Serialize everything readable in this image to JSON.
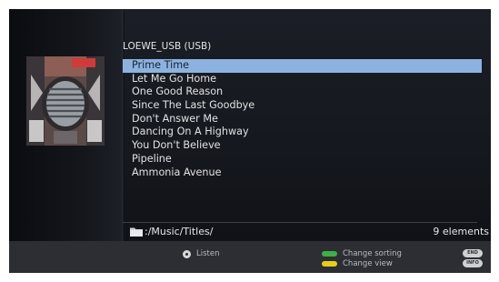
{
  "source": {
    "title": "LOEWE_USB (USB)"
  },
  "tracks": [
    {
      "title": "Prime Time",
      "selected": true
    },
    {
      "title": "Let Me Go Home"
    },
    {
      "title": "One Good Reason"
    },
    {
      "title": "Since The Last Goodbye"
    },
    {
      "title": "Don't Answer Me"
    },
    {
      "title": "Dancing On A Highway"
    },
    {
      "title": "You Don't Believe"
    },
    {
      "title": "Pipeline"
    },
    {
      "title": "Ammonia Avenue"
    }
  ],
  "footer": {
    "path": ":/Music/Titles/",
    "count": "9 elements"
  },
  "hints": {
    "listen": "Listen",
    "green": "Change sorting",
    "yellow": "Change view",
    "end_key": "END",
    "info_key": "INFO"
  },
  "colors": {
    "selection": "#8cb3df",
    "green_key": "#3fae49",
    "yellow_key": "#e3cf1b"
  },
  "icons": {
    "folder": "folder-icon",
    "ok": "ok-button-icon",
    "album": "album-art"
  }
}
